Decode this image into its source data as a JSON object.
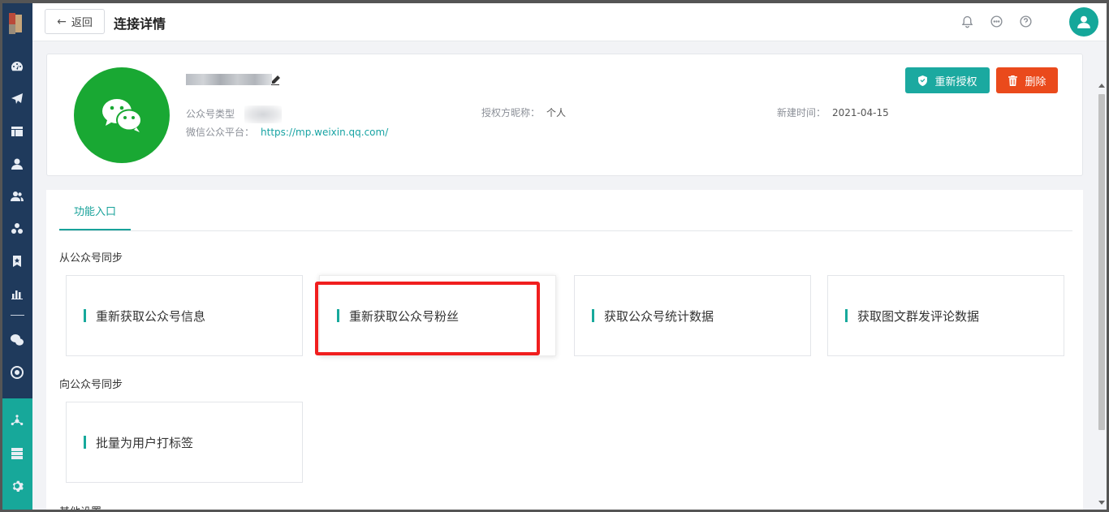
{
  "topbar": {
    "back_label": "返回",
    "title": "连接详情",
    "icons": [
      "bell-icon",
      "chat-icon",
      "help-icon",
      "user-icon"
    ]
  },
  "profile": {
    "type_label": "公众号类型",
    "auth_label": "授权方昵称：",
    "auth_value": "个人",
    "created_label": "新建时间：",
    "created_value": "2021-04-15",
    "platform_label": "微信公众平台：",
    "platform_link": "https://mp.weixin.qq.com/",
    "reauth_label": "重新授权",
    "delete_label": "删除"
  },
  "functions": {
    "tab_label": "功能入口",
    "sections": [
      {
        "title": "从公众号同步",
        "tiles": [
          "重新获取公众号信息",
          "重新获取公众号粉丝",
          "获取公众号统计数据",
          "获取图文群发评论数据"
        ]
      },
      {
        "title": "向公众号同步",
        "tiles": [
          "批量为用户打标签"
        ]
      },
      {
        "title": "其他设置",
        "tiles": []
      }
    ]
  },
  "colors": {
    "sidebar": "#1f3a5c",
    "accent": "#17a99c",
    "delete": "#ea4a1c",
    "wechat": "#19a833",
    "highlight": "#f01e1e"
  }
}
